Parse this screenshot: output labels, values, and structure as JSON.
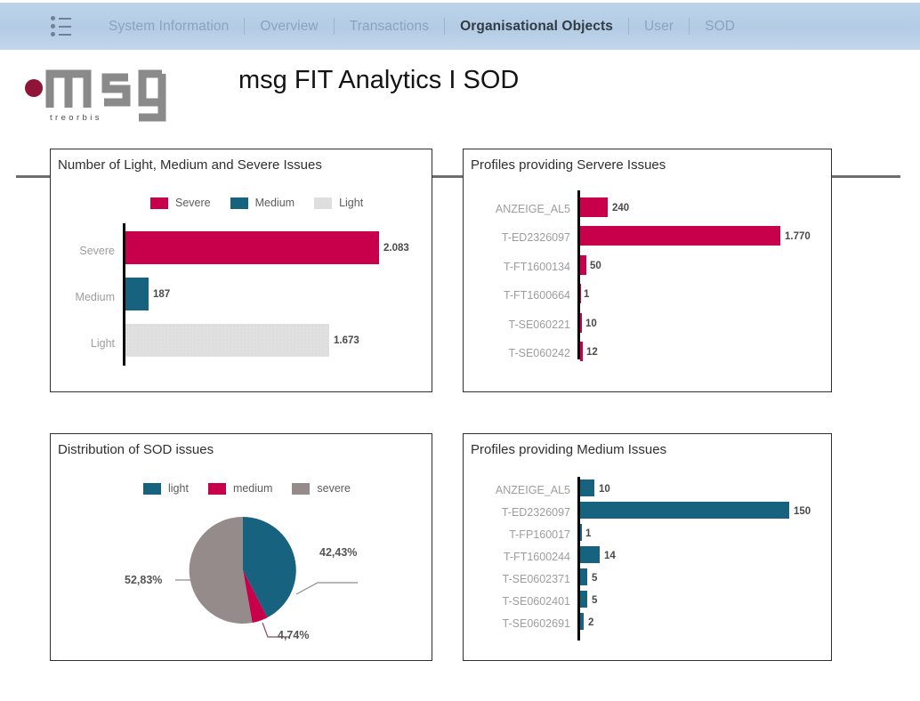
{
  "nav": {
    "menu_icon": "list-icon",
    "items": [
      {
        "label": "System Information",
        "active": false
      },
      {
        "label": "Overview",
        "active": false
      },
      {
        "label": "Transactions",
        "active": false
      },
      {
        "label": "Organisational Objects",
        "active": true
      },
      {
        "label": "User",
        "active": false
      },
      {
        "label": "SOD",
        "active": false
      }
    ]
  },
  "header": {
    "logo_text": "msg",
    "logo_subtext": "t r e o r b i s",
    "title": "msg FIT Analytics I SOD"
  },
  "colors": {
    "severe": "#c8004b",
    "medium": "#16627f",
    "light": "#dedede",
    "pie_severe": "#958b8b",
    "navbar": "#b3cbe4",
    "divider": "#6e6e6e"
  },
  "chart_data": [
    {
      "id": "number-of-issues",
      "type": "bar",
      "orientation": "horizontal",
      "title": "Number of Light, Medium and Severe Issues",
      "categories": [
        "Severe",
        "Medium",
        "Light"
      ],
      "values": [
        2083,
        187,
        1673
      ],
      "value_labels": [
        "2.083",
        "187",
        "1.673"
      ],
      "colors": [
        "#c8004b",
        "#16627f",
        "#dedede"
      ],
      "legend": [
        {
          "label": "Severe",
          "color": "#c8004b"
        },
        {
          "label": "Medium",
          "color": "#16627f"
        },
        {
          "label": "Light",
          "color": "#dedede"
        }
      ],
      "legend_position": "top",
      "xlabel": "",
      "ylabel": "",
      "grid": false,
      "xlim": [
        0,
        2083
      ]
    },
    {
      "id": "profiles-severe",
      "type": "bar",
      "orientation": "horizontal",
      "title": "Profiles providing Servere Issues",
      "categories": [
        "ANZEIGE_AL5",
        "T-ED2326097",
        "T-FT1600134",
        "T-FT1600664",
        "T-SE060221",
        "T-SE060242"
      ],
      "values": [
        240,
        1770,
        50,
        1,
        10,
        12
      ],
      "value_labels": [
        "240",
        "1.770",
        "50",
        "1",
        "10",
        "12"
      ],
      "series_color": "#c8004b",
      "xlabel": "",
      "ylabel": "",
      "grid": false,
      "xlim": [
        0,
        1770
      ]
    },
    {
      "id": "distribution-sod",
      "type": "pie",
      "title": "Distribution of SOD issues",
      "labels": [
        "light",
        "medium",
        "severe"
      ],
      "values": [
        42.43,
        4.74,
        52.83
      ],
      "value_labels": [
        "42,43%",
        "4,74%",
        "52,83%"
      ],
      "colors": [
        "#16627f",
        "#c8004b",
        "#958b8b"
      ],
      "legend": [
        {
          "label": "light",
          "color": "#16627f"
        },
        {
          "label": "medium",
          "color": "#c8004b"
        },
        {
          "label": "severe",
          "color": "#958b8b"
        }
      ],
      "legend_position": "top"
    },
    {
      "id": "profiles-medium",
      "type": "bar",
      "orientation": "horizontal",
      "title": "Profiles providing Medium Issues",
      "categories": [
        "ANZEIGE_AL5",
        "T-ED2326097",
        "T-FP160017",
        "T-FT1600244",
        "T-SE0602371",
        "T-SE0602401",
        "T-SE0602691"
      ],
      "values": [
        10,
        150,
        1,
        14,
        5,
        5,
        2
      ],
      "value_labels": [
        "10",
        "150",
        "1",
        "14",
        "5",
        "5",
        "2"
      ],
      "series_color": "#16627f",
      "xlabel": "",
      "ylabel": "",
      "grid": false,
      "xlim": [
        0,
        150
      ]
    }
  ]
}
